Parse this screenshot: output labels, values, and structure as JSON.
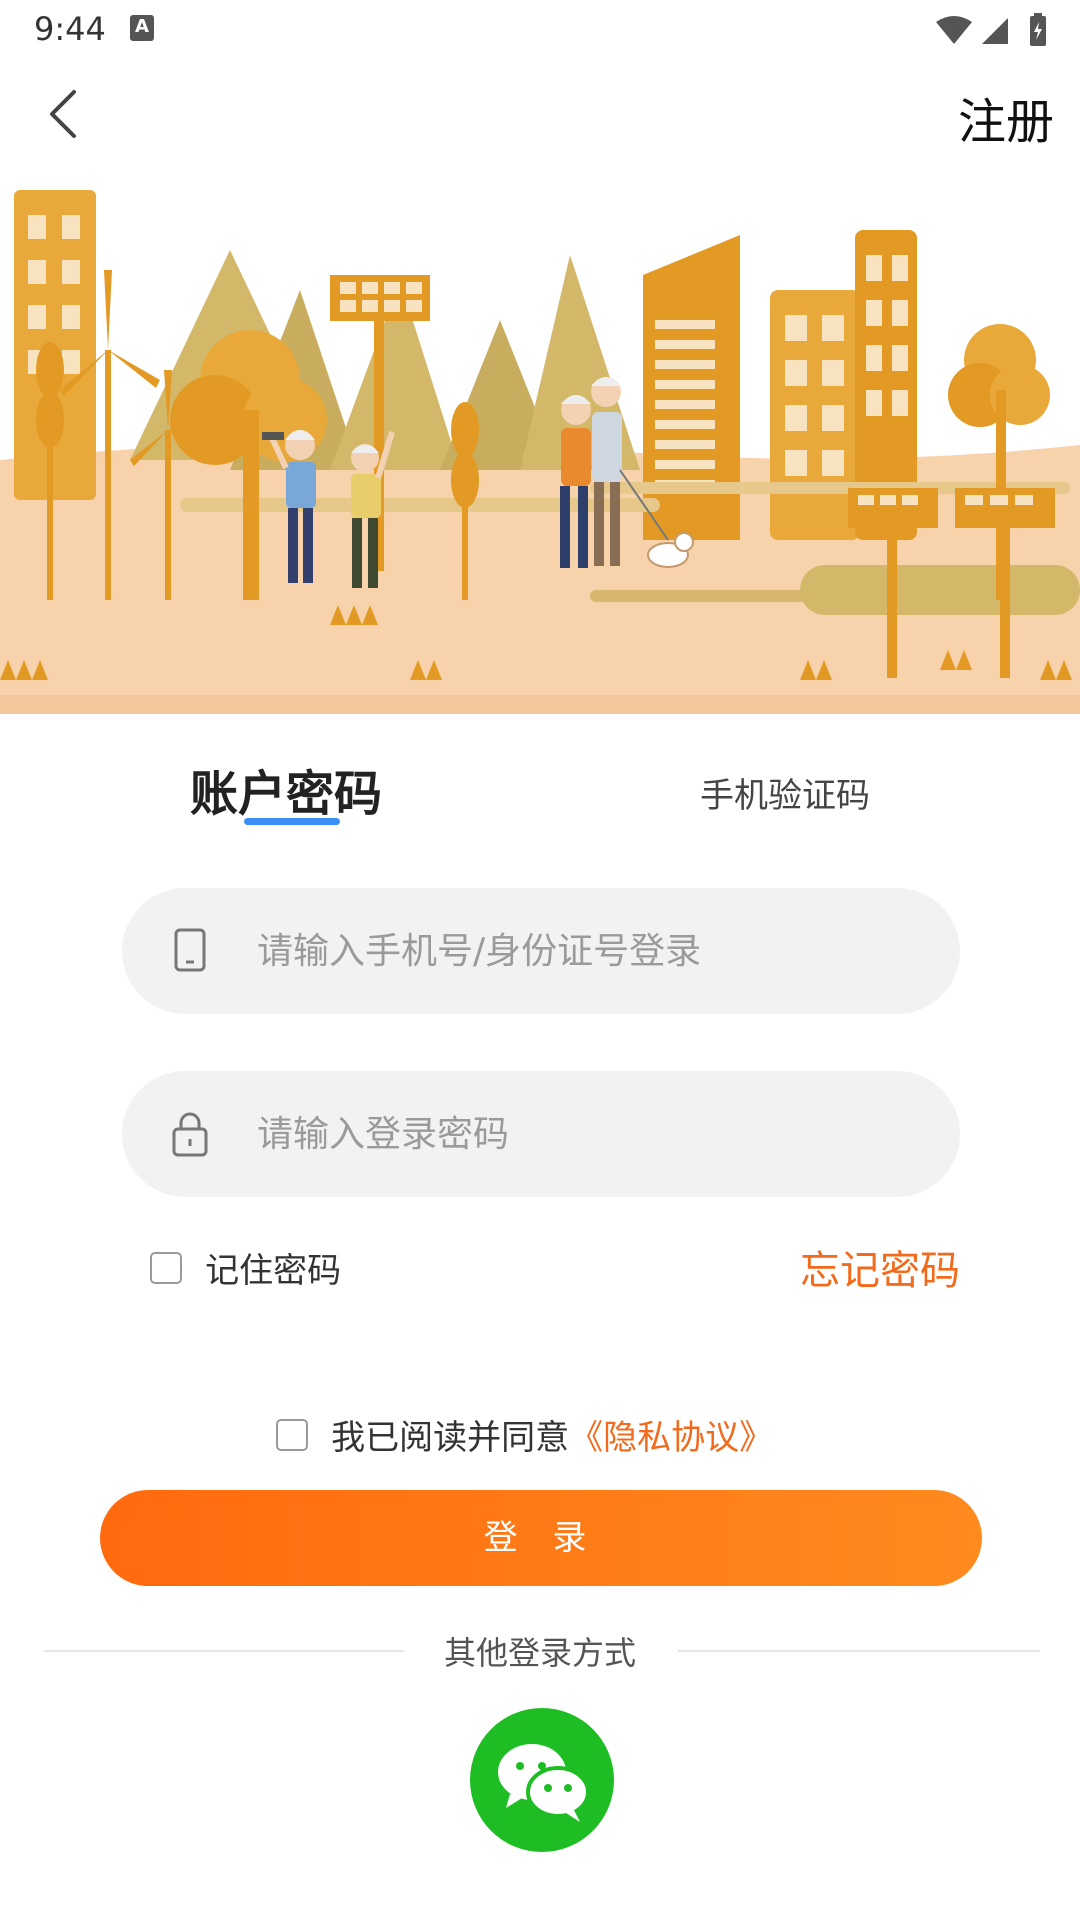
{
  "status": {
    "time": "9:44",
    "notif_letter": "A"
  },
  "header": {
    "register_label": "注册"
  },
  "tabs": {
    "account": "账户密码",
    "sms": "手机验证码"
  },
  "form": {
    "phone_placeholder": "请输入手机号/身份证号登录",
    "password_placeholder": "请输入登录密码",
    "remember_label": "记住密码",
    "forgot_label": "忘记密码"
  },
  "agreement": {
    "text": "我已阅读并同意",
    "link": "《隐私协议》"
  },
  "login_label": "登 录",
  "other_login": {
    "label": "其他登录方式",
    "wechat_icon": "wechat-icon"
  },
  "colors": {
    "accent": "#f26b1d",
    "tab_underline": "#3c8ff5",
    "wechat": "#1fbd24",
    "hero_ground": "#f8d2aa"
  }
}
